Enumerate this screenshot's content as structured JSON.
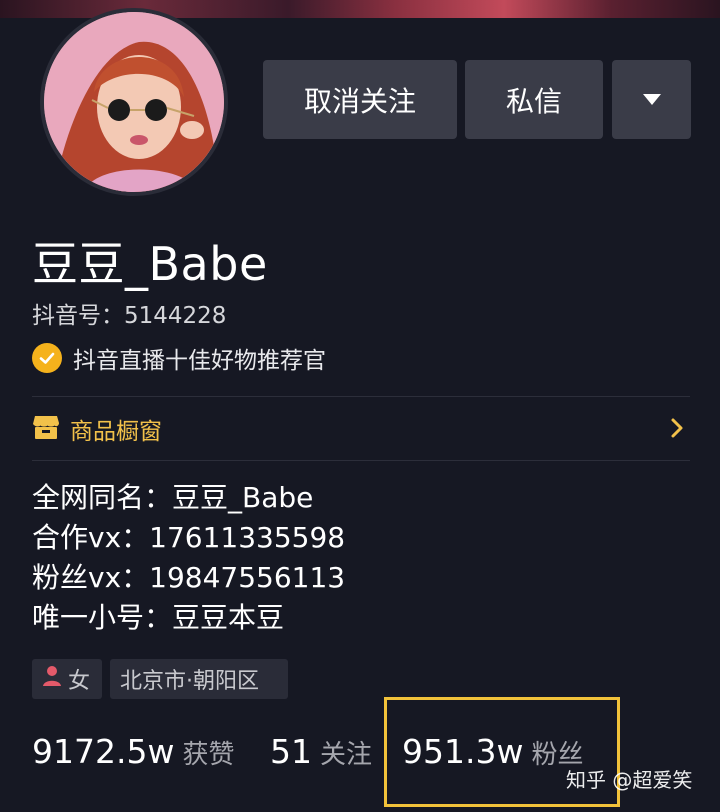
{
  "profile": {
    "name": "豆豆_Babe",
    "douyin_id": "抖音号：5144228",
    "verified_text": "抖音直播十佳好物推荐官",
    "verified_icon": "check-badge-icon"
  },
  "actions": {
    "unfollow_label": "取消关注",
    "message_label": "私信",
    "more_icon": "caret-down-icon"
  },
  "shop": {
    "label": "商品橱窗",
    "icon": "shop-icon",
    "chevron_icon": "chevron-right-icon"
  },
  "bio": [
    "全网同名：豆豆_Babe",
    "合作vx：17611335598",
    "粉丝vx：19847556113",
    "唯一小号：豆豆本豆"
  ],
  "tags": {
    "gender": "女",
    "gender_icon": "female-user-icon",
    "location": "北京市·朝阳区"
  },
  "stats": {
    "likes_value": "9172.5w",
    "likes_label": "获赞",
    "following_value": "51",
    "following_label": "关注",
    "fans_value": "951.3w",
    "fans_label": "粉丝"
  },
  "watermark": "知乎 @超爱笑",
  "colors": {
    "background": "#161823",
    "button": "#3a3c48",
    "accent_gold": "#f2c14a",
    "verified_badge": "#f5b21c",
    "highlight_box": "#f2c23a"
  }
}
